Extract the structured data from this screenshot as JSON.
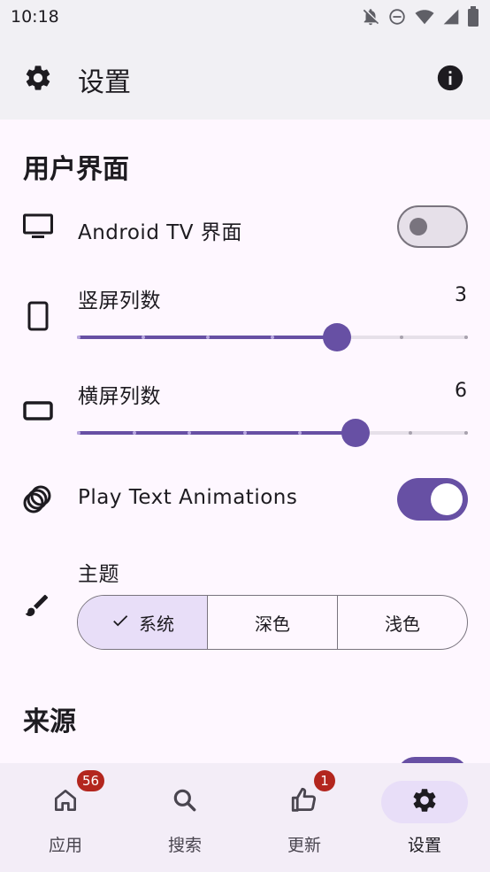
{
  "status_bar": {
    "time": "10:18",
    "icons": [
      "notifications-off-icon",
      "do-not-disturb-icon",
      "wifi-icon",
      "signal-icon",
      "battery-icon"
    ]
  },
  "app_bar": {
    "title": "设置",
    "leading_icon": "gear-icon",
    "trailing_icon": "info-icon"
  },
  "sections": {
    "ui_title": "用户界面",
    "sources_title": "来源"
  },
  "settings": {
    "android_tv": {
      "label": "Android TV 界面",
      "enabled": false,
      "icon": "tv-icon"
    },
    "portrait_columns": {
      "label": "竖屏列数",
      "value": "3",
      "icon": "phone-portrait-icon",
      "fraction": 0.667
    },
    "landscape_columns": {
      "label": "横屏列数",
      "value": "6",
      "icon": "phone-landscape-icon",
      "fraction": 0.714
    },
    "play_text_animations": {
      "label": "Play Text Animations",
      "enabled": true,
      "icon": "animation-icon"
    },
    "theme": {
      "label": "主题",
      "icon": "brush-icon",
      "options": [
        "系统",
        "深色",
        "浅色"
      ],
      "selected": "系统"
    }
  },
  "bottom_nav": {
    "items": [
      {
        "label": "应用",
        "icon": "home-icon",
        "badge": "56",
        "active": false
      },
      {
        "label": "搜索",
        "icon": "search-icon",
        "badge": "",
        "active": false
      },
      {
        "label": "更新",
        "icon": "thumb-up-icon",
        "badge": "1",
        "active": false
      },
      {
        "label": "设置",
        "icon": "gear-icon",
        "badge": "",
        "active": true
      }
    ]
  },
  "colors": {
    "primary": "#6750A4",
    "surface": "#FEF7FF",
    "app_bar_bg": "#F1F0F4",
    "nav_bg": "#F3EDF7",
    "selected_container": "#E8DEF8",
    "badge": "#B3261E"
  }
}
